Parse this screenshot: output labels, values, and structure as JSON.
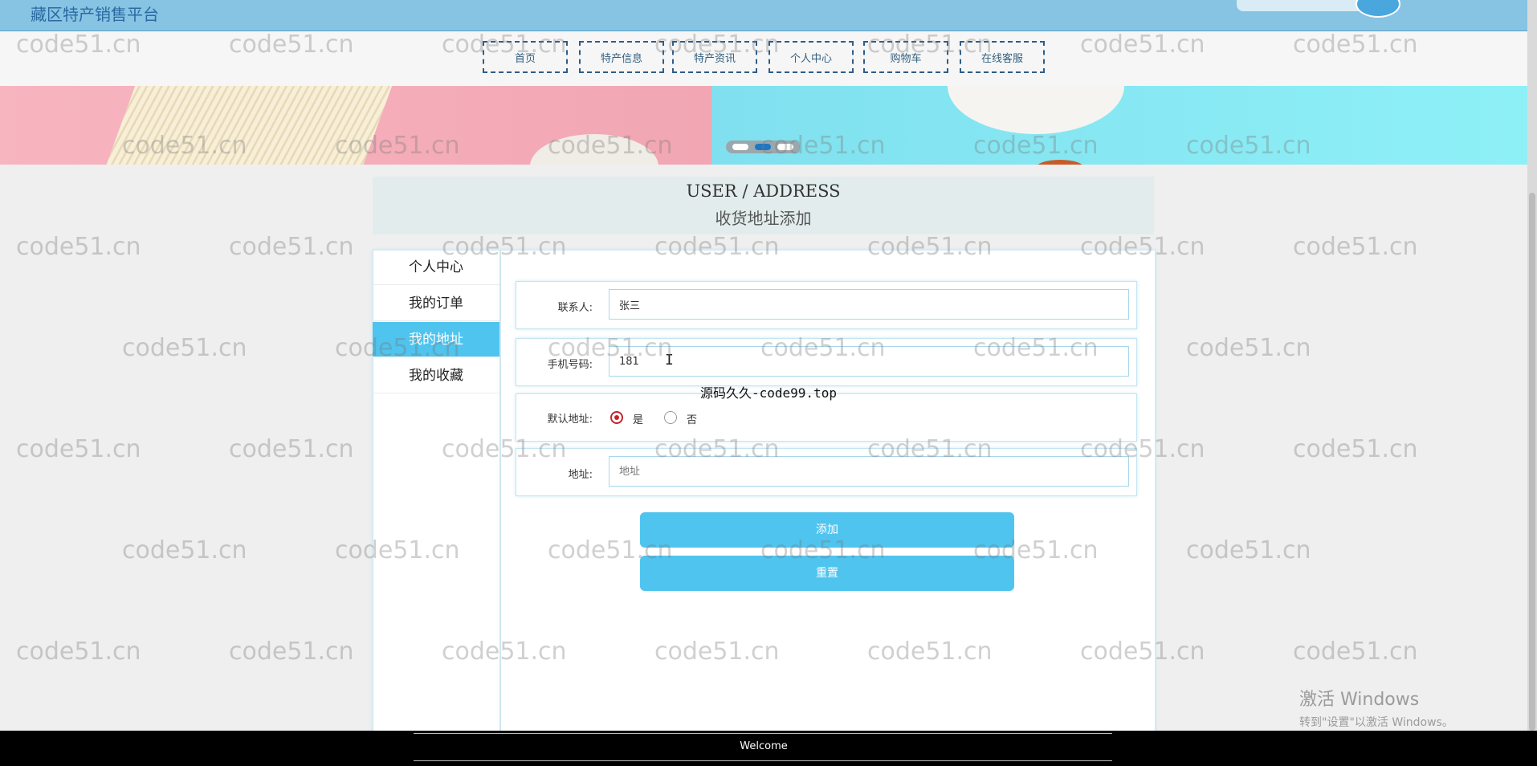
{
  "header": {
    "site_title": "藏区特产销售平台"
  },
  "nav": {
    "items": [
      "首页",
      "特产信息",
      "特产资讯",
      "个人中心",
      "购物车",
      "在线客服"
    ]
  },
  "page": {
    "title_en": "USER / ADDRESS",
    "title_cn": "收货地址添加"
  },
  "sidebar": {
    "items": [
      {
        "label": "个人中心",
        "active": false
      },
      {
        "label": "我的订单",
        "active": false
      },
      {
        "label": "我的地址",
        "active": true
      },
      {
        "label": "我的收藏",
        "active": false
      }
    ]
  },
  "form": {
    "contact_label": "联系人:",
    "contact_value": "张三",
    "phone_label": "手机号码:",
    "phone_value": "181",
    "default_label": "默认地址:",
    "default_yes": "是",
    "default_no": "否",
    "default_selected": "是",
    "address_label": "地址:",
    "address_placeholder": "地址",
    "submit_label": "添加",
    "reset_label": "重置"
  },
  "overlay": {
    "source_text": "源码久久-code99.top",
    "watermark": "code51.cn"
  },
  "os": {
    "activate_title": "激活 Windows",
    "activate_sub": "转到\"设置\"以激活 Windows。"
  },
  "footer": {
    "text": "Welcome"
  },
  "colors": {
    "accent": "#4fc4ef",
    "topbar": "#87c3e3",
    "nav_border": "#2e5d88"
  }
}
